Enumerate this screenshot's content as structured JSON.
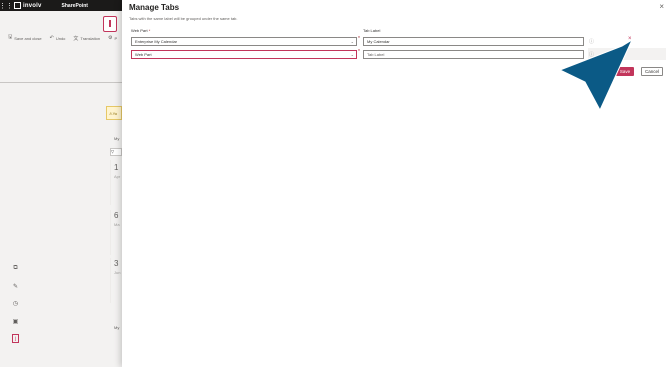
{
  "suite": {
    "brand": "involv",
    "app": "SharePoint"
  },
  "page": {
    "commands": [
      {
        "icon": "save-icon",
        "label": "Save and close"
      },
      {
        "icon": "undo-icon",
        "label": "Undo"
      },
      {
        "icon": "translation-icon",
        "label": "Translation"
      },
      {
        "icon": "more-icon",
        "label": "P"
      }
    ],
    "warning_text": "Yo",
    "section_label_1": "My",
    "section_label_2": "My",
    "days": [
      {
        "num": "1",
        "mon": "Apr"
      },
      {
        "num": "6",
        "mon": "Ma"
      },
      {
        "num": "3",
        "mon": "Jun"
      }
    ]
  },
  "panel": {
    "title": "Manage Tabs",
    "subtitle": "Tabs with the same label will be grouped under the same tab.",
    "col_webpart": "Web Part",
    "col_tablabel": "Tab Label",
    "required_mark": "*",
    "rows": [
      {
        "webpart": "Enterprise My Calendar",
        "label": "My Calendar"
      },
      {
        "webpart": "Web Part",
        "label": "Tab Label"
      }
    ],
    "save_label": "Save",
    "cancel_label": "Cancel",
    "close_glyph": "×",
    "accent": "#c2355b"
  },
  "annotation": {
    "arrow_color": "#0b5a86"
  }
}
